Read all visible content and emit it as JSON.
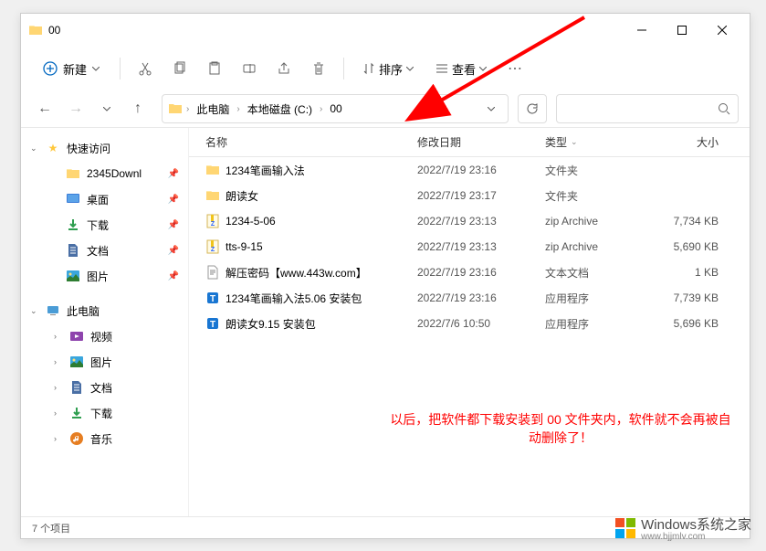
{
  "window": {
    "title": "00"
  },
  "toolbar": {
    "new_label": "新建",
    "sort_label": "排序",
    "view_label": "查看"
  },
  "breadcrumb": {
    "items": [
      "此电脑",
      "本地磁盘 (C:)",
      "00"
    ]
  },
  "sidebar": {
    "quick_access": "快速访问",
    "qa_items": [
      {
        "label": "2345Downl",
        "icon": "folder"
      },
      {
        "label": "桌面",
        "icon": "desktop"
      },
      {
        "label": "下载",
        "icon": "download"
      },
      {
        "label": "文档",
        "icon": "document"
      },
      {
        "label": "图片",
        "icon": "picture"
      }
    ],
    "this_pc": "此电脑",
    "pc_items": [
      {
        "label": "视频",
        "icon": "video"
      },
      {
        "label": "图片",
        "icon": "picture"
      },
      {
        "label": "文档",
        "icon": "document"
      },
      {
        "label": "下载",
        "icon": "download"
      },
      {
        "label": "音乐",
        "icon": "music"
      }
    ]
  },
  "headers": {
    "name": "名称",
    "date": "修改日期",
    "type": "类型",
    "size": "大小"
  },
  "files": [
    {
      "name": "1234笔画输入法",
      "date": "2022/7/19 23:16",
      "type": "文件夹",
      "size": "",
      "icon": "folder"
    },
    {
      "name": "朗读女",
      "date": "2022/7/19 23:17",
      "type": "文件夹",
      "size": "",
      "icon": "folder"
    },
    {
      "name": "1234-5-06",
      "date": "2022/7/19 23:13",
      "type": "zip Archive",
      "size": "7,734 KB",
      "icon": "zip"
    },
    {
      "name": "tts-9-15",
      "date": "2022/7/19 23:13",
      "type": "zip Archive",
      "size": "5,690 KB",
      "icon": "zip"
    },
    {
      "name": "解压密码【www.443w.com】",
      "date": "2022/7/19 23:16",
      "type": "文本文档",
      "size": "1 KB",
      "icon": "text"
    },
    {
      "name": "1234笔画输入法5.06 安装包",
      "date": "2022/7/19 23:16",
      "type": "应用程序",
      "size": "7,739 KB",
      "icon": "app"
    },
    {
      "name": "朗读女9.15 安装包",
      "date": "2022/7/6 10:50",
      "type": "应用程序",
      "size": "5,696 KB",
      "icon": "app"
    }
  ],
  "annotation": "以后，把软件都下载安装到 00 文件夹内，软件就不会再被自动删除了！",
  "status": "7 个项目",
  "watermark": {
    "main": "Windows系统之家",
    "sub": "www.bjjmlv.com"
  }
}
